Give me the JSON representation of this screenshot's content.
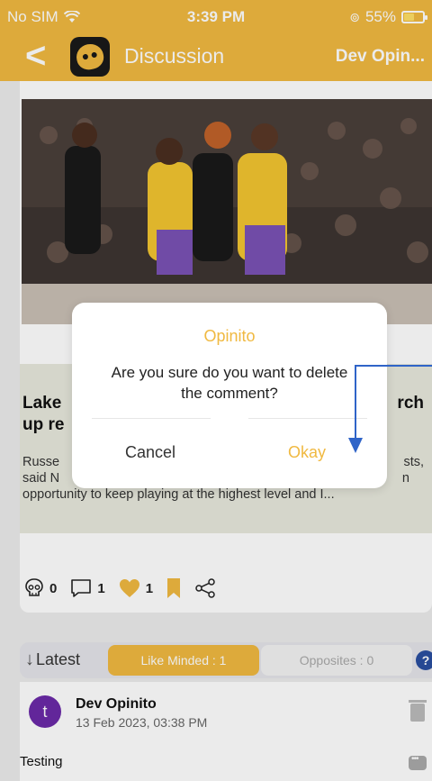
{
  "status": {
    "carrier": "No SIM",
    "time": "3:39 PM",
    "battery": "55%",
    "battery_level": 0.55
  },
  "nav": {
    "title": "Discussion",
    "right": "Dev Opin..."
  },
  "article": {
    "title": "Lake              rch up re",
    "title_line1": "Lake",
    "title_line1_right": "rch",
    "title_line2": "up re",
    "body_line1_left": "Russe",
    "body_line1_right": "sts,",
    "body_line2_left": "said N",
    "body_line2_right": "n",
    "body_line3": "opportunity to keep playing at the highest level and I..."
  },
  "actions": {
    "skull_count": "0",
    "comment_count": "1",
    "like_count": "1"
  },
  "filters": {
    "latest": "Latest",
    "like_minded": "Like Minded : 1",
    "opposites": "Opposites : 0",
    "help": "?"
  },
  "comment": {
    "avatar_letter": "t",
    "name": "Dev Opinito",
    "date": "13 Feb 2023, 03:38 PM",
    "text": "Testing"
  },
  "dialog": {
    "title": "Opinito",
    "message_line1": "Are you sure do you want to delete",
    "message_line2": "the comment?",
    "cancel": "Cancel",
    "okay": "Okay"
  },
  "colors": {
    "accent": "#f0b941",
    "annotation": "#2f64c8",
    "avatar": "#6b2aa8"
  }
}
